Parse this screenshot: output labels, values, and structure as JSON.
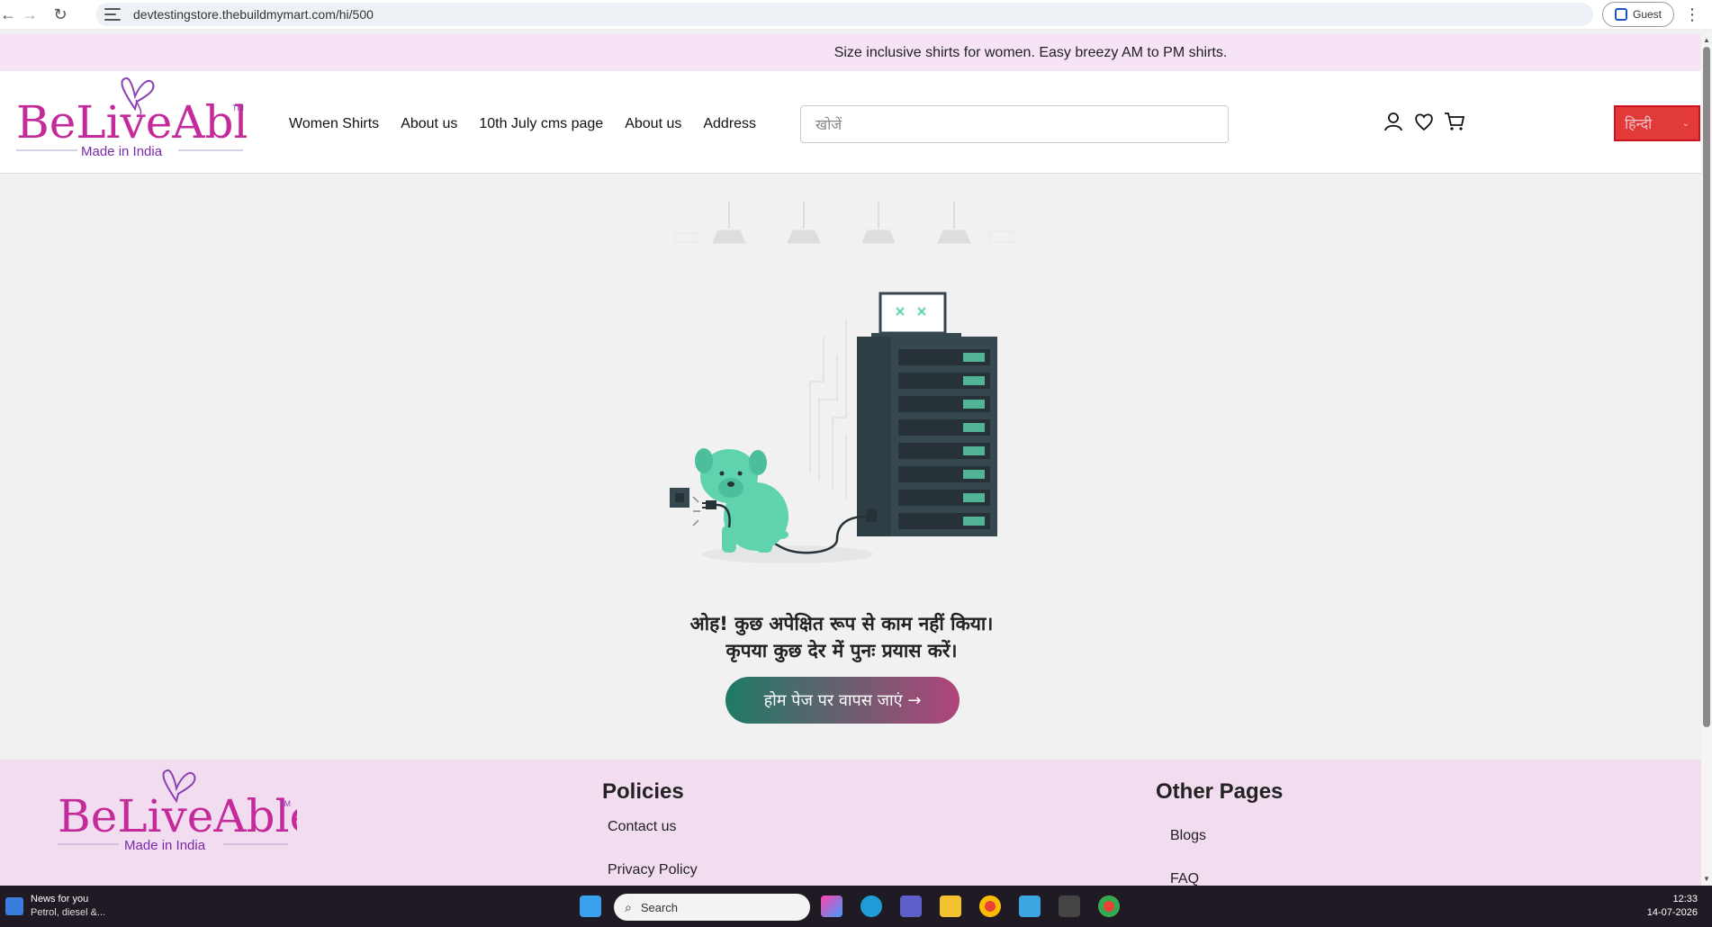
{
  "browser": {
    "url": "devtestingstore.thebuildmymart.com/hi/500",
    "profile_label": "Guest"
  },
  "announcement": "Size inclusive shirts for women. Easy breezy AM to PM shirts.",
  "header": {
    "logo": {
      "brand": "BeLiveAble",
      "tm": "TM",
      "tagline": "Made in India"
    },
    "nav": [
      "Women Shirts",
      "About us",
      "10th July cms page",
      "About us",
      "Address"
    ],
    "search_placeholder": "खोजें",
    "language": "हिन्दी"
  },
  "error": {
    "line1": "ओह! कुछ अपेक्षित रूप से काम नहीं किया।",
    "line2": "कृपया कुछ देर में पुनः प्रयास करें।",
    "home_button": "होम पेज पर वापस जाएं →"
  },
  "footer": {
    "logo": {
      "brand": "BeLiveAble",
      "tm": "TM",
      "tagline": "Made in India"
    },
    "policies_title": "Policies",
    "policies": [
      "Contact us",
      "Privacy Policy"
    ],
    "other_title": "Other Pages",
    "other": [
      "Blogs",
      "FAQ"
    ]
  },
  "taskbar": {
    "news_title": "News for you",
    "news_sub": "Petrol, diesel &...",
    "search_label": "Search",
    "time": "12:33",
    "date": "14-07-2026"
  },
  "colors": {
    "brand_magenta": "#c0238e",
    "brand_purple": "#7a2aa8",
    "announcement_bg": "#f6e3f5",
    "footer_bg": "#f2dcef",
    "language_bg": "#e23a36",
    "button_gradient_start": "#1f7a65",
    "button_gradient_end": "#b0457a",
    "illustration_teal": "#5fd3ae",
    "server_dark": "#37474f"
  }
}
